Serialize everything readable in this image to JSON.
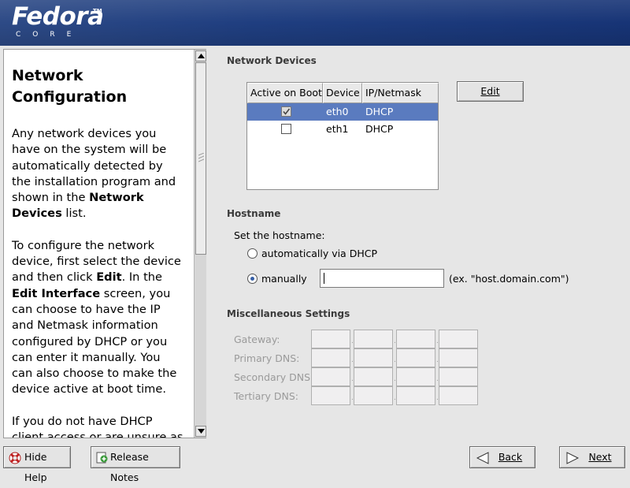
{
  "banner": {
    "brand": "Fedora",
    "tm": "TM",
    "subbrand": "CORE"
  },
  "help": {
    "title": "Network Configuration",
    "p1_a": "Any network devices you have on the system will be automatically detected by the installation program and shown in the ",
    "p1_b": "Network Devices",
    "p1_c": " list.",
    "p2_a": "To configure the network device, first select the device and then click ",
    "p2_b": "Edit",
    "p2_c": ". In the ",
    "p2_d": "Edit Interface",
    "p2_e": " screen, you can choose to have the IP and Netmask information configured by DHCP or you can enter it manually. You can also choose to make the device active at boot time.",
    "p3": "If you do not have DHCP client access or are unsure as to what this information is, please"
  },
  "network_devices": {
    "title": "Network Devices",
    "columns": [
      "Active on Boot",
      "Device",
      "IP/Netmask"
    ],
    "rows": [
      {
        "active": true,
        "device": "eth0",
        "ip": "DHCP",
        "selected": true
      },
      {
        "active": false,
        "device": "eth1",
        "ip": "DHCP",
        "selected": false
      }
    ],
    "edit_button": "Edit"
  },
  "hostname": {
    "title": "Hostname",
    "prompt": "Set the hostname:",
    "option_dhcp": "automatically via DHCP",
    "option_manual": "manually",
    "selected": "manually",
    "value": "",
    "example": "(ex. \"host.domain.com\")"
  },
  "misc": {
    "title": "Miscellaneous Settings",
    "fields": [
      "Gateway:",
      "Primary DNS:",
      "Secondary DNS:",
      "Tertiary DNS:"
    ]
  },
  "footer": {
    "hide_help": "Hide Help",
    "release_notes": "Release Notes",
    "back": "Back",
    "next": "Next"
  },
  "colors": {
    "banner": "#1f3e80",
    "selection": "#5a7bbf"
  }
}
